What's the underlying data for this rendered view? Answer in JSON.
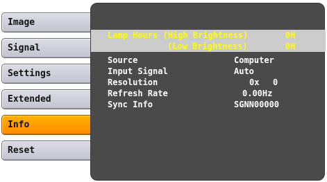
{
  "menu": {
    "items": [
      {
        "label": "Image"
      },
      {
        "label": "Signal"
      },
      {
        "label": "Settings"
      },
      {
        "label": "Extended"
      },
      {
        "label": "Info"
      },
      {
        "label": "Reset"
      }
    ],
    "active_index": 4
  },
  "info": {
    "lamp_hours_label": "Lamp Hours (High Brightness)",
    "lamp_hours_high_value": "0H",
    "low_brightness_label": "(Low Brightness)",
    "lamp_hours_low_value": "0H",
    "source_label": "Source",
    "source_value": "Computer",
    "input_signal_label": "Input Signal",
    "input_signal_value": "Auto",
    "resolution_label": "Resolution",
    "resolution_h": "0x",
    "resolution_v": "0",
    "refresh_rate_label": "Refresh Rate",
    "refresh_rate_value": "0.00Hz",
    "sync_info_label": "Sync Info",
    "sync_info_value": "SGNN00000"
  },
  "colors": {
    "panel_bg": "#4a4a4a",
    "highlight_row": "#cccccc",
    "highlight_text": "#ffff00",
    "active_menu": "#ff9900",
    "menu_bg": "#d0d0dc"
  }
}
